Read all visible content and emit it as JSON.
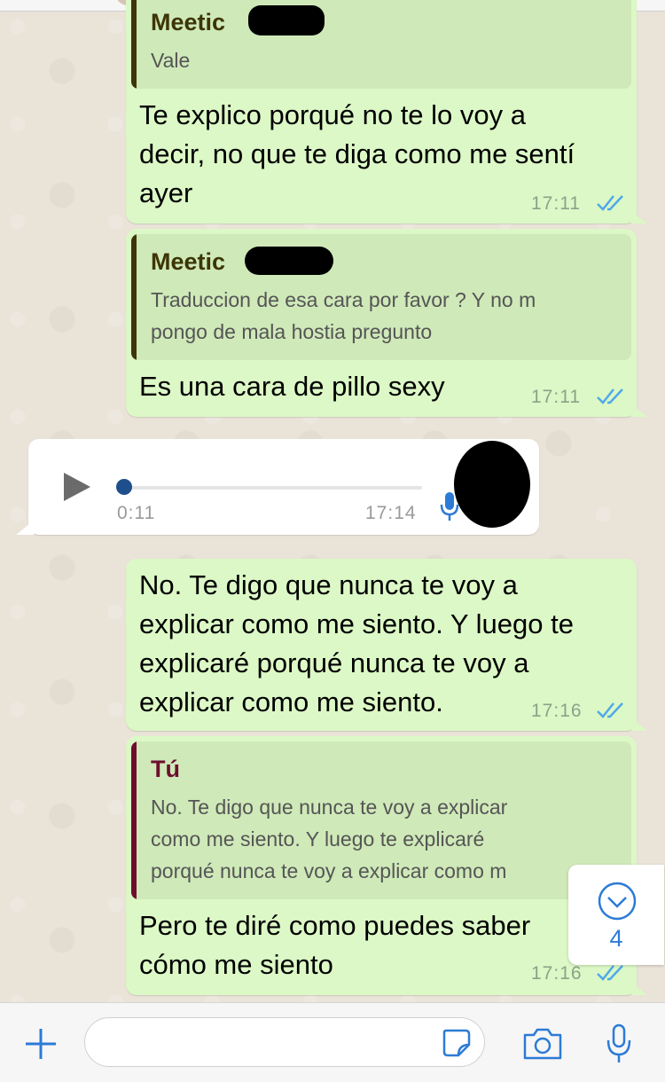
{
  "colors": {
    "outgoing_bubble": "#dcf8c6",
    "incoming_bubble": "#ffffff",
    "tick_blue": "#4fa9e8",
    "meetic_author": "#3d3506",
    "self_author": "#6e0e2e",
    "accent_blue": "#2c7bd6"
  },
  "messages": [
    {
      "reply_to": {
        "author": "Meetic",
        "text": [
          "Vale"
        ]
      },
      "text": [
        "Te explico porqué no te lo voy a",
        "decir, no que te diga como me sentí",
        "ayer"
      ],
      "time": "17:11",
      "status": "read"
    },
    {
      "reply_to": {
        "author": "Meetic",
        "text": [
          "Traduccion de esa cara por favor ? Y no m",
          "pongo de mala hostia pregunto"
        ]
      },
      "text": [
        "Es una cara de pillo sexy"
      ],
      "time": "17:11",
      "status": "read"
    },
    {
      "voice_note": {
        "duration": "0:11",
        "time": "17:14",
        "progress": 0
      }
    },
    {
      "text": [
        "No. Te digo que nunca te voy a",
        "explicar como me siento. Y luego te",
        "explicaré porqué nunca te voy a",
        "explicar como me siento."
      ],
      "time": "17:16",
      "status": "read"
    },
    {
      "reply_to": {
        "author": "Tú",
        "text": [
          "No. Te digo que nunca te voy a explicar",
          "como me siento. Y luego te explicaré",
          "porqué nunca te voy a explicar como m"
        ]
      },
      "text": [
        "Pero te diré como puedes saber",
        "cómo me siento"
      ],
      "time": "17:16",
      "status": "read"
    }
  ],
  "scroll_to_bottom": {
    "icon": "chevron-down-icon",
    "unread_count": "4"
  },
  "input_bar": {
    "add_icon": "plus-icon",
    "sticker_icon": "sticker-icon",
    "camera_icon": "camera-icon",
    "mic_icon": "microphone-icon",
    "placeholder": ""
  }
}
